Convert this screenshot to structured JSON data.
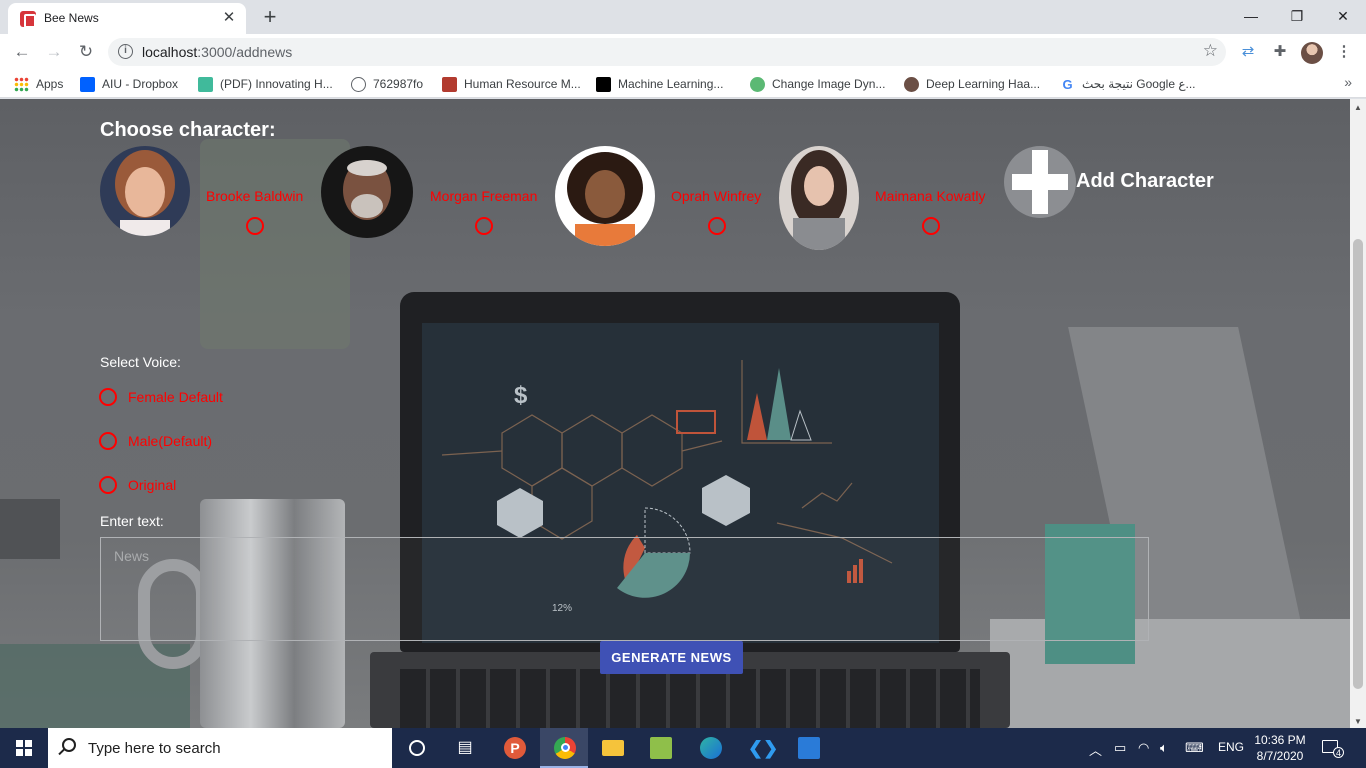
{
  "browser": {
    "tab_title": "Bee News",
    "tab_close": "✕",
    "new_tab": "+",
    "window_controls": {
      "minimize": "—",
      "restore": "❐",
      "close": "✕"
    },
    "url_host": "localhost",
    "url_path": ":3000/addnews"
  },
  "bookmarks": [
    {
      "label": "Apps",
      "icon": "apps-grid-icon"
    },
    {
      "label": "AIU - Dropbox",
      "icon": "dropbox-icon",
      "color": "#0061ff"
    },
    {
      "label": "(PDF) Innovating H...",
      "icon": "researchgate-icon",
      "color": "#40ba9b"
    },
    {
      "label": "762987fo",
      "icon": "globe-icon",
      "color": "#5f6368"
    },
    {
      "label": "Human Resource M...",
      "icon": "book-icon",
      "color": "#b23b2f"
    },
    {
      "label": "Machine Learning...",
      "icon": "medium-icon",
      "color": "#000000"
    },
    {
      "label": "Change Image Dyn...",
      "icon": "gear-icon",
      "color": "#5bb974"
    },
    {
      "label": "Deep Learning Haa...",
      "icon": "person-icon",
      "color": "#6b4f45"
    },
    {
      "label": "نتيجة بحث Google ع...",
      "icon": "google-icon",
      "color": "#4285f4"
    }
  ],
  "page": {
    "choose_title": "Choose character:",
    "characters": [
      {
        "name": "Brooke Baldwin"
      },
      {
        "name": "Morgan Freeman"
      },
      {
        "name": "Oprah Winfrey"
      },
      {
        "name": "Maimana Kowatly"
      }
    ],
    "add_character": "Add Character",
    "select_voice": "Select Voice:",
    "voices": [
      "Female Default",
      "Male(Default)",
      "Original"
    ],
    "enter_text": "Enter text:",
    "news_placeholder": "News",
    "generate_button": "GENERATE NEWS"
  },
  "taskbar": {
    "search_placeholder": "Type here to search",
    "language": "ENG",
    "time": "10:36 PM",
    "date": "8/7/2020",
    "notification_count": "4"
  },
  "colors": {
    "accent_red": "#ff0000",
    "button_indigo": "#3f51b5",
    "taskbar": "#1c2a4a"
  }
}
